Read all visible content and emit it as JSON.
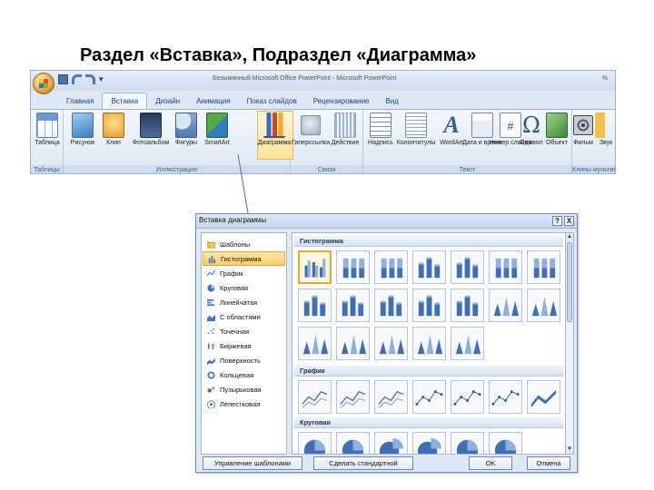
{
  "slide": {
    "title": "Раздел «Вставка», Подраздел «Диаграмма»"
  },
  "window": {
    "title": "Безымянный Microsoft Office PowerPoint - Microsoft PowerPoint",
    "edge": "%"
  },
  "ribbon": {
    "tabs": [
      "Главная",
      "Вставка",
      "Дизайн",
      "Анимация",
      "Показ слайдов",
      "Рецензирование",
      "Вид"
    ],
    "active_tab": "Вставка",
    "groups": [
      {
        "label": "Таблицы",
        "buttons": [
          "Таблица"
        ]
      },
      {
        "label": "Иллюстрации",
        "buttons": [
          "Рисунок",
          "Клип",
          "Фотоальбом",
          "Фигуры",
          "SmartArt",
          "Диаграмма"
        ]
      },
      {
        "label": "Связи",
        "buttons": [
          "Гиперссылка",
          "Действие"
        ]
      },
      {
        "label": "Текст",
        "buttons": [
          "Надпись",
          "Колонтитулы",
          "WordArt",
          "Дата и время",
          "Номер слайда",
          "Символ",
          "Объект"
        ]
      },
      {
        "label": "Клипы мультимедиа",
        "buttons": [
          "Фильм",
          "Звук"
        ]
      }
    ]
  },
  "dialog": {
    "title": "Вставка диаграммы",
    "title_buttons": [
      "?",
      "X"
    ],
    "categories": [
      {
        "label": "Шаблоны",
        "icon": "folder-icon"
      },
      {
        "label": "Гистограмма",
        "icon": "column-chart-icon",
        "selected": true
      },
      {
        "label": "График",
        "icon": "line-chart-icon"
      },
      {
        "label": "Круговая",
        "icon": "pie-chart-icon"
      },
      {
        "label": "Линейчатая",
        "icon": "bar-chart-icon"
      },
      {
        "label": "С областями",
        "icon": "area-chart-icon"
      },
      {
        "label": "Точечная",
        "icon": "scatter-chart-icon"
      },
      {
        "label": "Биржевая",
        "icon": "stock-chart-icon"
      },
      {
        "label": "Поверхность",
        "icon": "surface-chart-icon"
      },
      {
        "label": "Кольцевая",
        "icon": "doughnut-chart-icon"
      },
      {
        "label": "Пузырьковая",
        "icon": "bubble-chart-icon"
      },
      {
        "label": "Лепестковая",
        "icon": "radar-chart-icon"
      }
    ],
    "sections": [
      {
        "label": "Гистограмма"
      },
      {
        "label": "График"
      },
      {
        "label": "Круговая"
      }
    ],
    "buttons": {
      "manage": "Управление шаблонами",
      "default": "Сделать стандартной",
      "ok": "OK",
      "cancel": "Отмена"
    },
    "scroll": {
      "up": "▲",
      "down": "▼"
    }
  },
  "colors": {
    "ribbon_bg": "#dfe9f5",
    "dialog_bg": "#dfe9f5",
    "selection": "#ffcd69",
    "accent": "#15428b",
    "connector": "#4a6fa5"
  }
}
